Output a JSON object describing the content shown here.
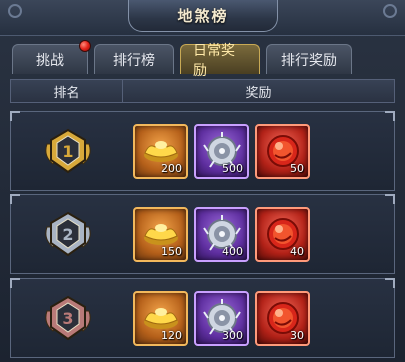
{
  "window": {
    "title": "地煞榜"
  },
  "tabs": [
    {
      "label": "挑战",
      "has_notification": true,
      "active": false
    },
    {
      "label": "排行榜",
      "active": false
    },
    {
      "label": "日常奖励",
      "active": true
    },
    {
      "label": "排行奖励",
      "active": false
    }
  ],
  "table": {
    "headers": {
      "rank": "排名",
      "reward": "奖励"
    },
    "rows": [
      {
        "rank": "1",
        "rewards": [
          {
            "icon": "gold-ingot-icon",
            "quantity": "200"
          },
          {
            "icon": "silver-emblem-icon",
            "quantity": "500"
          },
          {
            "icon": "red-orb-icon",
            "quantity": "50"
          }
        ]
      },
      {
        "rank": "2",
        "rewards": [
          {
            "icon": "gold-ingot-icon",
            "quantity": "150"
          },
          {
            "icon": "silver-emblem-icon",
            "quantity": "400"
          },
          {
            "icon": "red-orb-icon",
            "quantity": "40"
          }
        ]
      },
      {
        "rank": "3",
        "rewards": [
          {
            "icon": "gold-ingot-icon",
            "quantity": "120"
          },
          {
            "icon": "silver-emblem-icon",
            "quantity": "300"
          },
          {
            "icon": "red-orb-icon",
            "quantity": "30"
          }
        ]
      }
    ]
  },
  "colors": {
    "rank1": "#d8a93a",
    "rank2": "#a9b4c4",
    "rank3": "#b97a78",
    "active_tab": "#c8a955"
  }
}
